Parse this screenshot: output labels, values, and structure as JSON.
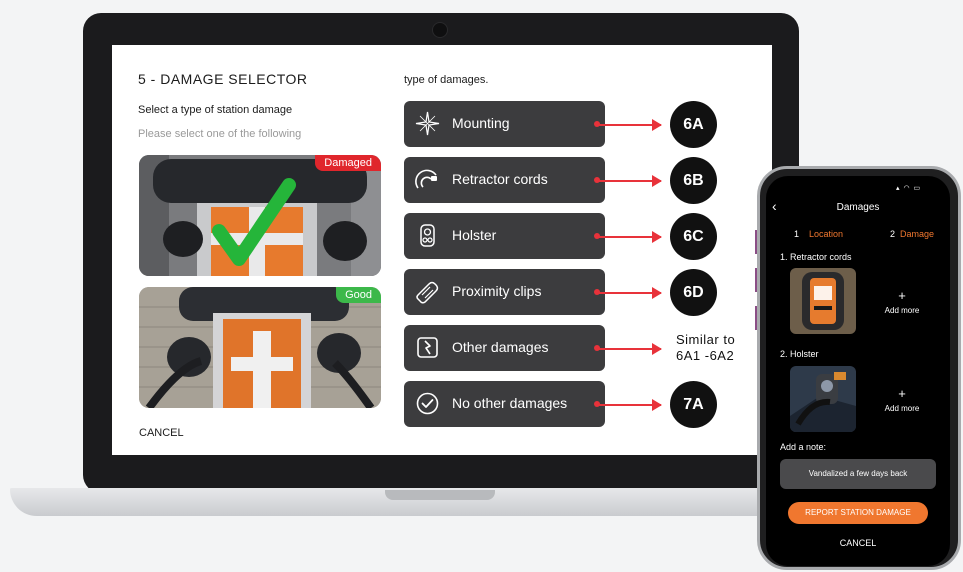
{
  "laptop_screen": {
    "title": "5 - DAMAGE SELECTOR",
    "subtitle": "Select a type of station damage",
    "hint": "Please select one of the following",
    "photos": [
      {
        "badge": "Damaged",
        "badge_color": "#e0262c"
      },
      {
        "badge": "Good",
        "badge_color": "#3cb84a"
      }
    ],
    "cancel_label": "CANCEL",
    "options_heading": "type of damages.",
    "options": [
      {
        "label": "Mounting",
        "icon": "compass-star-icon",
        "target": "6A"
      },
      {
        "label": "Retractor cords",
        "icon": "cord-icon",
        "target": "6B"
      },
      {
        "label": "Holster",
        "icon": "holster-icon",
        "target": "6C"
      },
      {
        "label": "Proximity clips",
        "icon": "clip-icon",
        "target": "6D"
      },
      {
        "label": "Other damages",
        "icon": "lightning-box-icon",
        "target": "Similar to 6A1 -6A2"
      },
      {
        "label": "No other damages",
        "icon": "check-circle-icon",
        "target": "7A"
      }
    ],
    "similar_line1": "Similar to",
    "similar_line2": "6A1 -6A2"
  },
  "phone": {
    "title": "Damages",
    "steps": {
      "step1_num": "1",
      "step1_label": "Location",
      "step2_num": "2",
      "step2_label": "Damage"
    },
    "items": [
      {
        "label": "1.  Retractor cords",
        "add_plus": "+",
        "add_text": "Add more"
      },
      {
        "label": "2.  Holster",
        "add_plus": "+",
        "add_text": "Add more"
      }
    ],
    "note_label": "Add a note:",
    "note_value": "Vandalized a few days back",
    "report_label": "REPORT STATION DAMAGE",
    "cancel_label": "CANCEL"
  },
  "colors": {
    "accent_red": "#e8323a",
    "accent_orange": "#f0772f",
    "option_bg": "#3c3c3e"
  }
}
